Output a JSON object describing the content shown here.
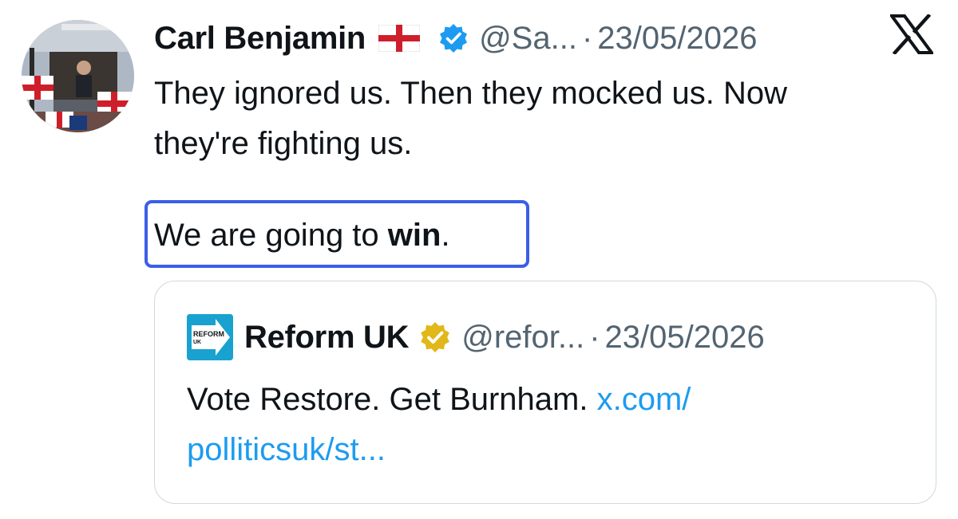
{
  "tweet": {
    "author": {
      "display_name": "Carl Benjamin",
      "flag_emoji": "england-flag-icon",
      "handle": "@Sa...",
      "verified": true,
      "badge_color": "#1d9bf0"
    },
    "separator": "·",
    "date": "23/05/2026",
    "text_lines": [
      "They ignored us. Then they mocked us. Now",
      "they're fighting us."
    ],
    "highlight": {
      "prefix": "We are going to ",
      "bold": "win",
      "suffix": ".",
      "border_color": "#3b5ee8"
    },
    "platform_logo": "x-logo-icon"
  },
  "quoted": {
    "author": {
      "display_name": "Reform UK",
      "handle": "@refor...",
      "badge_color": "#e2b719",
      "logo_text_line1": "REFORM",
      "logo_text_line2": "UK",
      "logo_color": "#19a2cf"
    },
    "separator": "·",
    "date": "23/05/2026",
    "text": "Vote Restore. Get Burnham. ",
    "link_part1": "x.com/",
    "link_part2": "polliticsuk/st...",
    "link_color": "#1d9bf0"
  }
}
